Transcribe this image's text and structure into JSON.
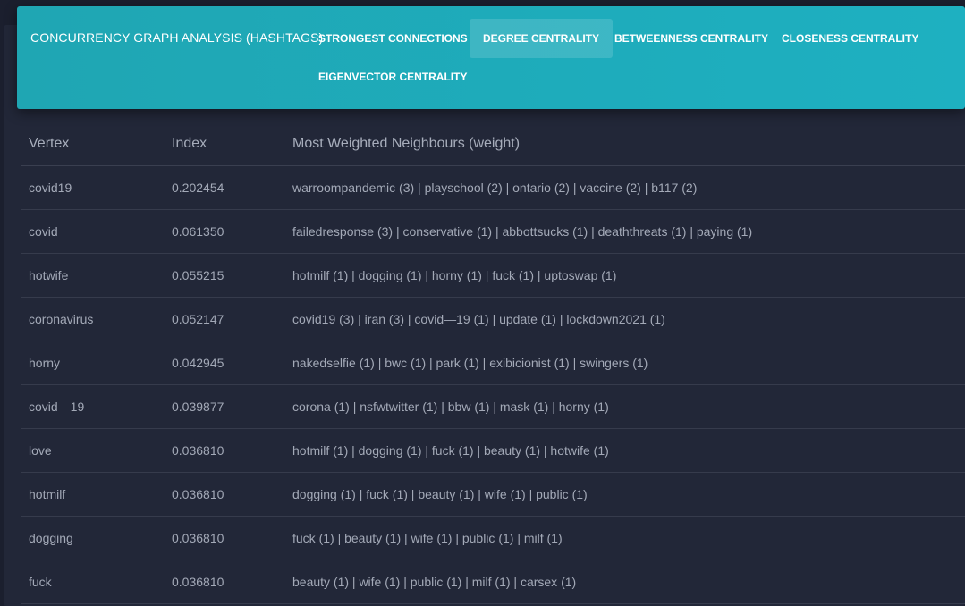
{
  "header": {
    "brand": "CONCURRENCY GRAPH ANALYSIS (HASHTAGS)",
    "tabs": [
      {
        "label": "STRONGEST CONNECTIONS",
        "active": false
      },
      {
        "label": "DEGREE CENTRALITY",
        "active": true
      },
      {
        "label": "BETWEENNESS CENTRALITY",
        "active": false
      },
      {
        "label": "CLOSENESS CENTRALITY",
        "active": false
      },
      {
        "label": "EIGENVECTOR CENTRALITY",
        "active": false
      }
    ]
  },
  "table": {
    "columns": [
      "Vertex",
      "Index",
      "Most Weighted Neighbours (weight)"
    ],
    "rows": [
      {
        "vertex": "covid19",
        "index": "0.202454",
        "neighbours": "warroompandemic (3) | playschool (2) | ontario (2) | vaccine (2) | b117 (2)"
      },
      {
        "vertex": "covid",
        "index": "0.061350",
        "neighbours": "failedresponse (3) | conservative (1) | abbottsucks (1) | deaththreats (1) | paying (1)"
      },
      {
        "vertex": "hotwife",
        "index": "0.055215",
        "neighbours": "hotmilf (1) | dogging (1) | horny (1) | fuck (1) | uptoswap (1)"
      },
      {
        "vertex": "coronavirus",
        "index": "0.052147",
        "neighbours": "covid19 (3) | iran (3) | covid—19 (1) | update (1) | lockdown2021 (1)"
      },
      {
        "vertex": "horny",
        "index": "0.042945",
        "neighbours": "nakedselfie (1) | bwc (1) | park (1) | exibicionist (1) | swingers (1)"
      },
      {
        "vertex": "covid—19",
        "index": "0.039877",
        "neighbours": "corona (1) | nsfwtwitter (1) | bbw (1) | mask (1) | horny (1)"
      },
      {
        "vertex": "love",
        "index": "0.036810",
        "neighbours": "hotmilf (1) | dogging (1) | fuck (1) | beauty (1) | hotwife (1)"
      },
      {
        "vertex": "hotmilf",
        "index": "0.036810",
        "neighbours": "dogging (1) | fuck (1) | beauty (1) | wife (1) | public (1)"
      },
      {
        "vertex": "dogging",
        "index": "0.036810",
        "neighbours": "fuck (1) | beauty (1) | wife (1) | public (1) | milf (1)"
      },
      {
        "vertex": "fuck",
        "index": "0.036810",
        "neighbours": "beauty (1) | wife (1) | public (1) | milf (1) | carsex (1)"
      }
    ]
  },
  "colors": {
    "header_start": "#1fa6b3",
    "header_end": "#1eb0c1",
    "background": "#222738",
    "text": "#a3a9b7"
  }
}
